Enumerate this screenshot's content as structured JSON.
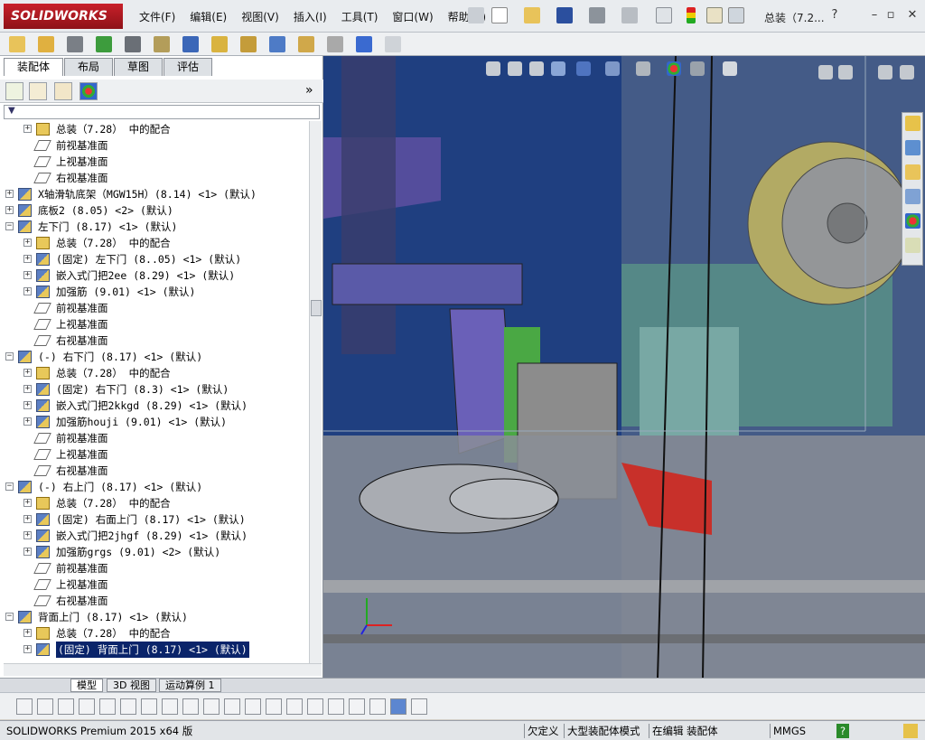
{
  "app": {
    "logo_text": "SOLIDWORKS",
    "doc_title": "总装（7.2...",
    "menu": [
      "文件(F)",
      "编辑(E)",
      "视图(V)",
      "插入(I)",
      "工具(T)",
      "窗口(W)",
      "帮助(H)"
    ],
    "window_controls": {
      "help": "?",
      "minimize": "–",
      "restore": "▫",
      "close": "✕"
    }
  },
  "panel": {
    "tabs": [
      "装配体",
      "布局",
      "草图",
      "评估"
    ],
    "expand_glyph": "»",
    "tree": [
      {
        "indent": 1,
        "exp": "+",
        "icon": "mate",
        "label": "总装（7.28） 中的配合"
      },
      {
        "indent": 1,
        "exp": "",
        "icon": "plane",
        "label": "前视基准面"
      },
      {
        "indent": 1,
        "exp": "",
        "icon": "plane",
        "label": "上视基准面"
      },
      {
        "indent": 1,
        "exp": "",
        "icon": "plane",
        "label": "右视基准面"
      },
      {
        "indent": 0,
        "exp": "+",
        "icon": "asm",
        "label": "X轴滑轨底架（MGW15H）(8.14) <1> (默认)"
      },
      {
        "indent": 0,
        "exp": "+",
        "icon": "asm",
        "label": "底板2 (8.05) <2> (默认)"
      },
      {
        "indent": 0,
        "exp": "−",
        "icon": "asm",
        "label": "左下门 (8.17) <1> (默认)"
      },
      {
        "indent": 1,
        "exp": "+",
        "icon": "mate",
        "label": "总装（7.28） 中的配合"
      },
      {
        "indent": 1,
        "exp": "+",
        "icon": "asm",
        "label": "(固定) 左下门 (8..05) <1> (默认)"
      },
      {
        "indent": 1,
        "exp": "+",
        "icon": "asm",
        "label": "嵌入式门把2ee (8.29) <1> (默认)"
      },
      {
        "indent": 1,
        "exp": "+",
        "icon": "asm",
        "label": "加强筋 (9.01) <1> (默认)"
      },
      {
        "indent": 1,
        "exp": "",
        "icon": "plane",
        "label": "前视基准面"
      },
      {
        "indent": 1,
        "exp": "",
        "icon": "plane",
        "label": "上视基准面"
      },
      {
        "indent": 1,
        "exp": "",
        "icon": "plane",
        "label": "右视基准面"
      },
      {
        "indent": 0,
        "exp": "−",
        "icon": "asm",
        "label": "(-) 右下门 (8.17) <1> (默认)"
      },
      {
        "indent": 1,
        "exp": "+",
        "icon": "mate",
        "label": "总装（7.28） 中的配合"
      },
      {
        "indent": 1,
        "exp": "+",
        "icon": "asm",
        "label": "(固定) 右下门 (8.3) <1> (默认)"
      },
      {
        "indent": 1,
        "exp": "+",
        "icon": "asm",
        "label": "嵌入式门把2kkgd (8.29) <1> (默认)"
      },
      {
        "indent": 1,
        "exp": "+",
        "icon": "asm",
        "label": "加强筋houji (9.01) <1> (默认)"
      },
      {
        "indent": 1,
        "exp": "",
        "icon": "plane",
        "label": "前视基准面"
      },
      {
        "indent": 1,
        "exp": "",
        "icon": "plane",
        "label": "上视基准面"
      },
      {
        "indent": 1,
        "exp": "",
        "icon": "plane",
        "label": "右视基准面"
      },
      {
        "indent": 0,
        "exp": "−",
        "icon": "asm",
        "label": "(-) 右上门 (8.17) <1> (默认)"
      },
      {
        "indent": 1,
        "exp": "+",
        "icon": "mate",
        "label": "总装（7.28） 中的配合"
      },
      {
        "indent": 1,
        "exp": "+",
        "icon": "asm",
        "label": "(固定) 右面上门 (8.17) <1> (默认)"
      },
      {
        "indent": 1,
        "exp": "+",
        "icon": "asm",
        "label": "嵌入式门把2jhgf (8.29) <1> (默认)"
      },
      {
        "indent": 1,
        "exp": "+",
        "icon": "asm",
        "label": "加强筋grgs (9.01) <2> (默认)"
      },
      {
        "indent": 1,
        "exp": "",
        "icon": "plane",
        "label": "前视基准面"
      },
      {
        "indent": 1,
        "exp": "",
        "icon": "plane",
        "label": "上视基准面"
      },
      {
        "indent": 1,
        "exp": "",
        "icon": "plane",
        "label": "右视基准面"
      },
      {
        "indent": 0,
        "exp": "−",
        "icon": "asm",
        "label": "背面上门 (8.17) <1> (默认)"
      },
      {
        "indent": 1,
        "exp": "+",
        "icon": "mate",
        "label": "总装（7.28） 中的配合"
      },
      {
        "indent": 1,
        "exp": "+",
        "icon": "asm",
        "label": "(固定) 背面上门 (8.17) <1> (默认)",
        "selected": true
      }
    ]
  },
  "bottom_tabs": [
    "模型",
    "3D 视图",
    "运动算例 1"
  ],
  "status": {
    "version": "SOLIDWORKS Premium 2015 x64 版",
    "underdefined": "欠定义",
    "large_mode": "大型装配体模式",
    "editing": "在编辑 装配体",
    "units": "MMGS"
  },
  "colors": {
    "accent": "#0a246a",
    "viewport_bg": "#1f3f80",
    "logo_red": "#c8202a"
  }
}
